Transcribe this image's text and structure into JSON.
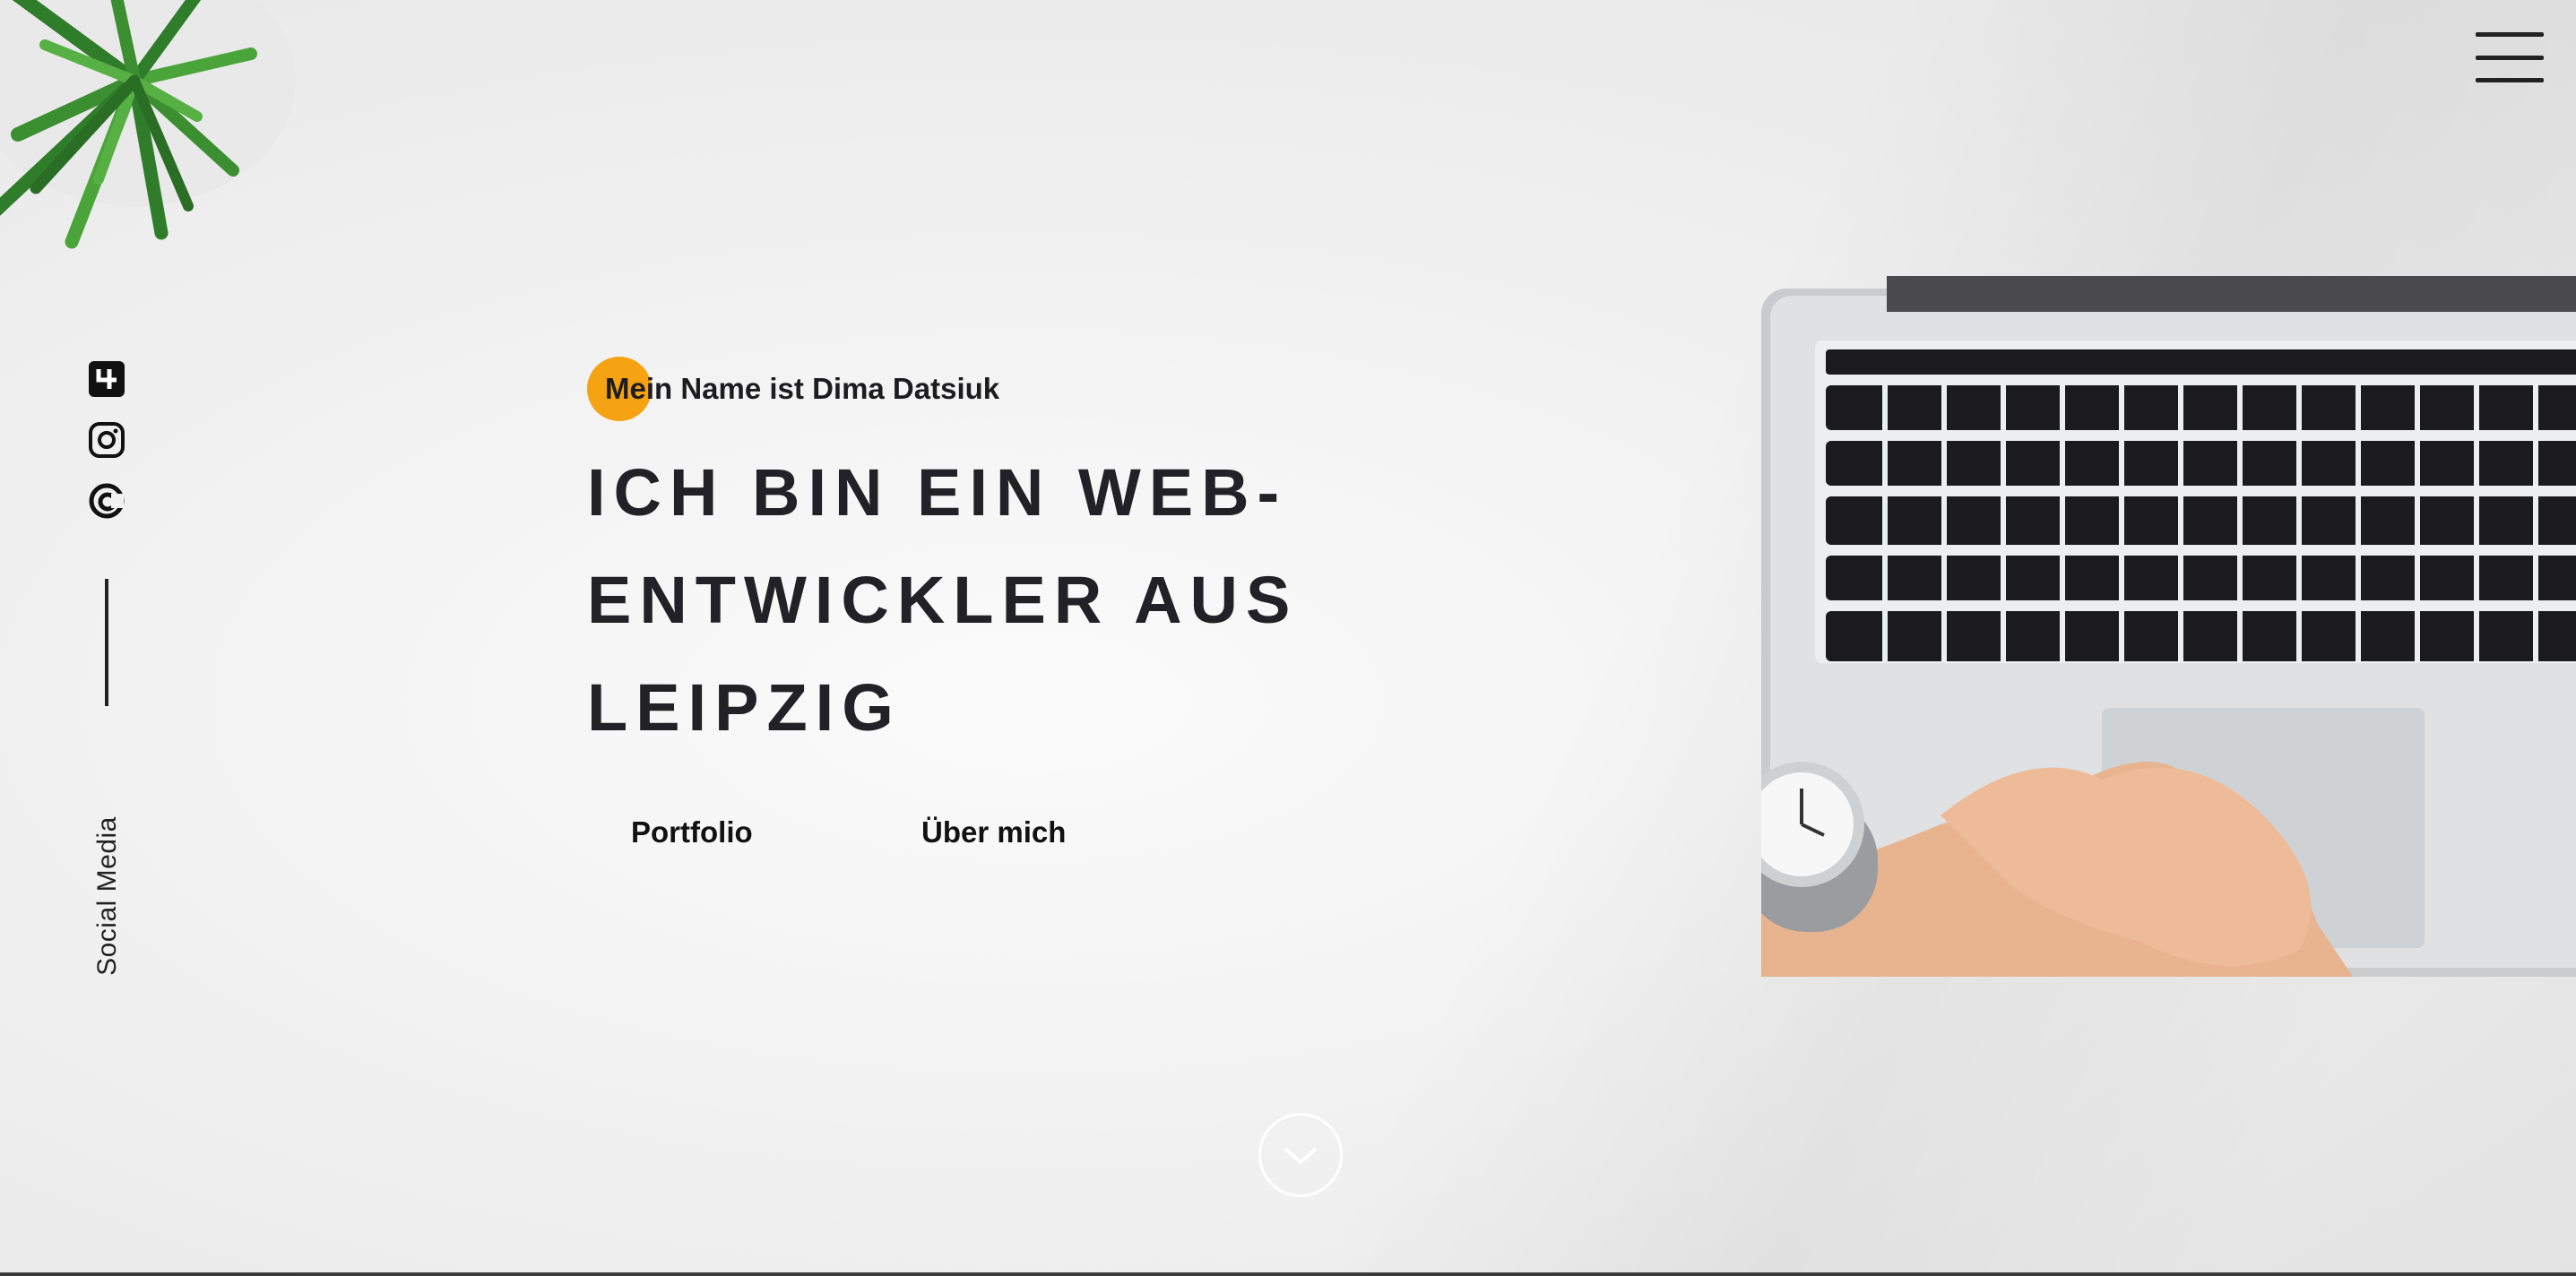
{
  "intro": {
    "text": "Mein Name ist Dima Datsiuk"
  },
  "headline": {
    "lines": [
      "ICH BIN EIN WEB-",
      "ENTWICKLER AUS",
      "LEIPZIG"
    ]
  },
  "buttons": {
    "portfolio": "Portfolio",
    "about": "Über mich"
  },
  "social": {
    "label": "Social Media",
    "icons": [
      "profile-square-icon",
      "instagram-icon",
      "codepen-c-icon"
    ]
  },
  "icons": {
    "menu": "hamburger-menu-icon",
    "scroll": "chevron-down-icon"
  },
  "colors": {
    "accent": "#f5a312",
    "text": "#222226"
  }
}
